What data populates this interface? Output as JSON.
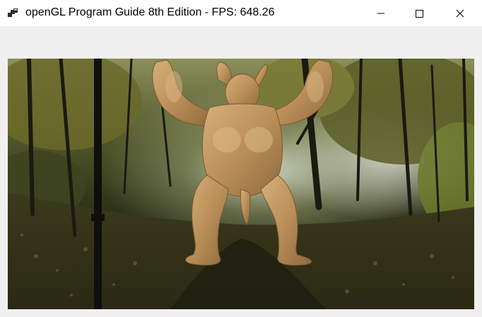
{
  "window": {
    "title": "openGL Program Guide 8th Edition - FPS: 648.26",
    "icon": "app-window-icon",
    "controls": {
      "minimize_icon": "minimize-icon",
      "maximize_icon": "maximize-icon",
      "close_icon": "close-icon"
    }
  },
  "viewport": {
    "background": "forest-park-path-skybox",
    "model": "armadillo-3d-model",
    "model_color": "#c49a63"
  }
}
